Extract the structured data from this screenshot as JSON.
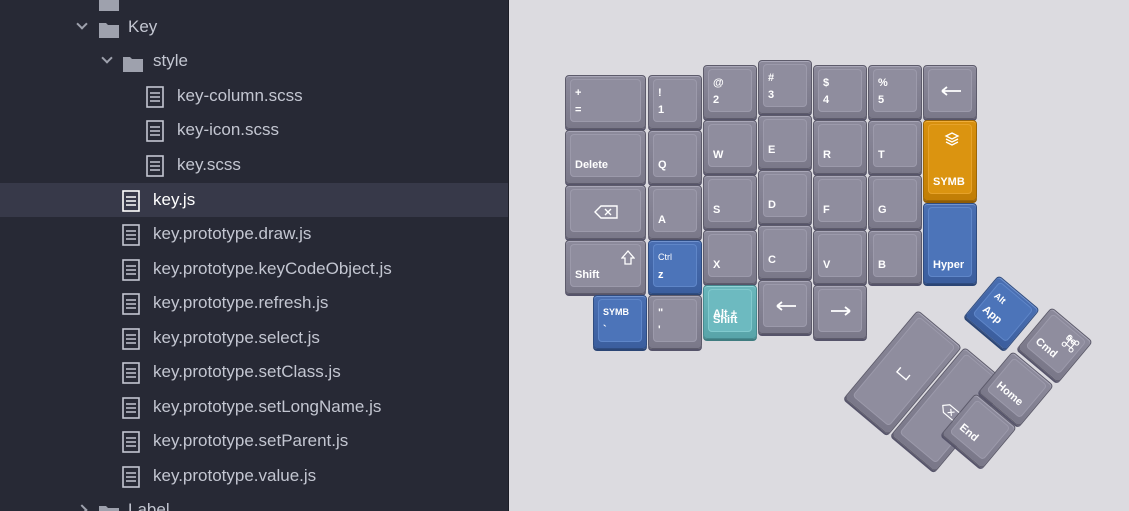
{
  "tree": {
    "items": [
      {
        "label": "Key",
        "type": "folder",
        "expanded": true
      },
      {
        "label": "style",
        "type": "folder",
        "expanded": true
      },
      {
        "label": "key-column.scss",
        "type": "file"
      },
      {
        "label": "key-icon.scss",
        "type": "file"
      },
      {
        "label": "key.scss",
        "type": "file"
      },
      {
        "label": "key.js",
        "type": "file",
        "selected": true
      },
      {
        "label": "key.prototype.draw.js",
        "type": "file"
      },
      {
        "label": "key.prototype.keyCodeObject.js",
        "type": "file"
      },
      {
        "label": "key.prototype.refresh.js",
        "type": "file"
      },
      {
        "label": "key.prototype.select.js",
        "type": "file"
      },
      {
        "label": "key.prototype.setClass.js",
        "type": "file"
      },
      {
        "label": "key.prototype.setLongName.js",
        "type": "file"
      },
      {
        "label": "key.prototype.setParent.js",
        "type": "file"
      },
      {
        "label": "key.prototype.value.js",
        "type": "file"
      },
      {
        "label": "Label",
        "type": "folder",
        "expanded": false
      }
    ]
  },
  "keyboard": {
    "colors": {
      "grey": "#8f8d9e",
      "blue": "#4c74b9",
      "orange": "#db9410",
      "teal": "#6dbac0"
    },
    "keys": {
      "plus_equals": {
        "top": "+",
        "bottom": "="
      },
      "excl_1": {
        "top": "!",
        "bottom": "1"
      },
      "at_2": {
        "top": "@",
        "bottom": "2"
      },
      "hash_3": {
        "top": "#",
        "bottom": "3"
      },
      "dollar_4": {
        "top": "$",
        "bottom": "4"
      },
      "percent_5": {
        "top": "%",
        "bottom": "5"
      },
      "arrow_left_top": {
        "icon": "arrow-left-icon"
      },
      "delete": {
        "bottom": "Delete"
      },
      "q": {
        "bottom": "Q"
      },
      "w": {
        "bottom": "W"
      },
      "e": {
        "bottom": "E"
      },
      "r": {
        "bottom": "R"
      },
      "t": {
        "bottom": "T"
      },
      "symb_orange": {
        "bottom": "SYMB",
        "icon": "layers-icon"
      },
      "backspace": {
        "icon": "backspace-icon"
      },
      "a": {
        "bottom": "A"
      },
      "s": {
        "bottom": "S"
      },
      "d": {
        "bottom": "D"
      },
      "f": {
        "bottom": "F"
      },
      "g": {
        "bottom": "G"
      },
      "hyper": {
        "bottom": "Hyper"
      },
      "shift": {
        "bottom": "Shift",
        "icon": "shift-arrow-icon"
      },
      "ctrl_z": {
        "top": "Ctrl",
        "bottom": "z"
      },
      "x": {
        "bottom": "X"
      },
      "c": {
        "bottom": "C"
      },
      "v": {
        "bottom": "V"
      },
      "b": {
        "bottom": "B"
      },
      "symb_blue": {
        "top": "SYMB",
        "bottom": "`"
      },
      "quote": {
        "top": "\"",
        "bottom": "'"
      },
      "alt_shift": {
        "top": "Alt +",
        "bottom": "Shift"
      },
      "arrow_left": {
        "icon": "arrow-left-icon"
      },
      "arrow_right": {
        "icon": "arrow-right-icon"
      },
      "space": {
        "icon": "space-icon"
      },
      "backspace_thumb": {
        "icon": "backspace-icon"
      },
      "alt_app": {
        "top": "Alt",
        "bottom": "App"
      },
      "cmd": {
        "label": "Cmd",
        "icon": "command-icon"
      },
      "home": {
        "label": "Home"
      },
      "end": {
        "label": "End"
      }
    }
  }
}
